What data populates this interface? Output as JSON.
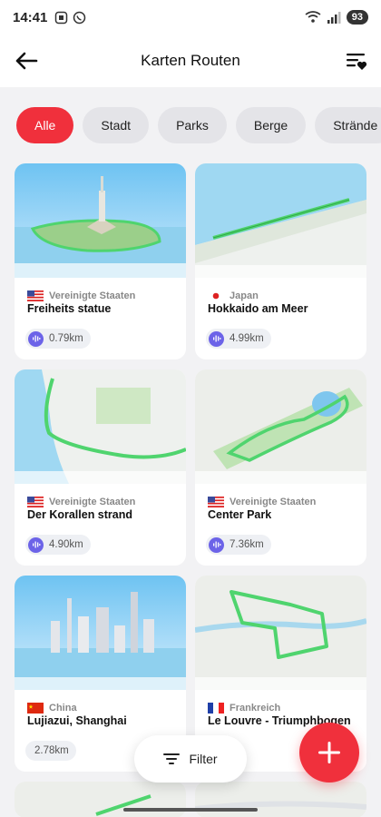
{
  "status": {
    "time": "14:41",
    "battery": "93"
  },
  "header": {
    "title": "Karten Routen"
  },
  "chips": [
    {
      "label": "Alle",
      "active": true
    },
    {
      "label": "Stadt",
      "active": false
    },
    {
      "label": "Parks",
      "active": false
    },
    {
      "label": "Berge",
      "active": false
    },
    {
      "label": "Strände",
      "active": false
    }
  ],
  "routes": [
    {
      "country": "Vereinigte Staaten",
      "name": "Freiheits statue",
      "distance": "0.79km",
      "flag": "us-flag-icon"
    },
    {
      "country": "Japan",
      "name": "Hokkaido am Meer",
      "distance": "4.99km",
      "flag": "japan-flag-icon"
    },
    {
      "country": "Vereinigte Staaten",
      "name": "Der Korallen strand",
      "distance": "4.90km",
      "flag": "us-flag-icon"
    },
    {
      "country": "Vereinigte Staaten",
      "name": "Center Park",
      "distance": "7.36km",
      "flag": "us-flag-icon"
    },
    {
      "country": "China",
      "name": "Lujiazui, Shanghai",
      "distance": "2.78km",
      "flag": "china-flag-icon"
    },
    {
      "country": "Frankreich",
      "name": "Le Louvre - Triumphbogen",
      "distance": "",
      "flag": "france-flag-icon"
    }
  ],
  "filter": {
    "label": "Filter"
  },
  "colors": {
    "accent": "#f0303c",
    "audio": "#6c63e8",
    "route": "#3fcf5e"
  }
}
